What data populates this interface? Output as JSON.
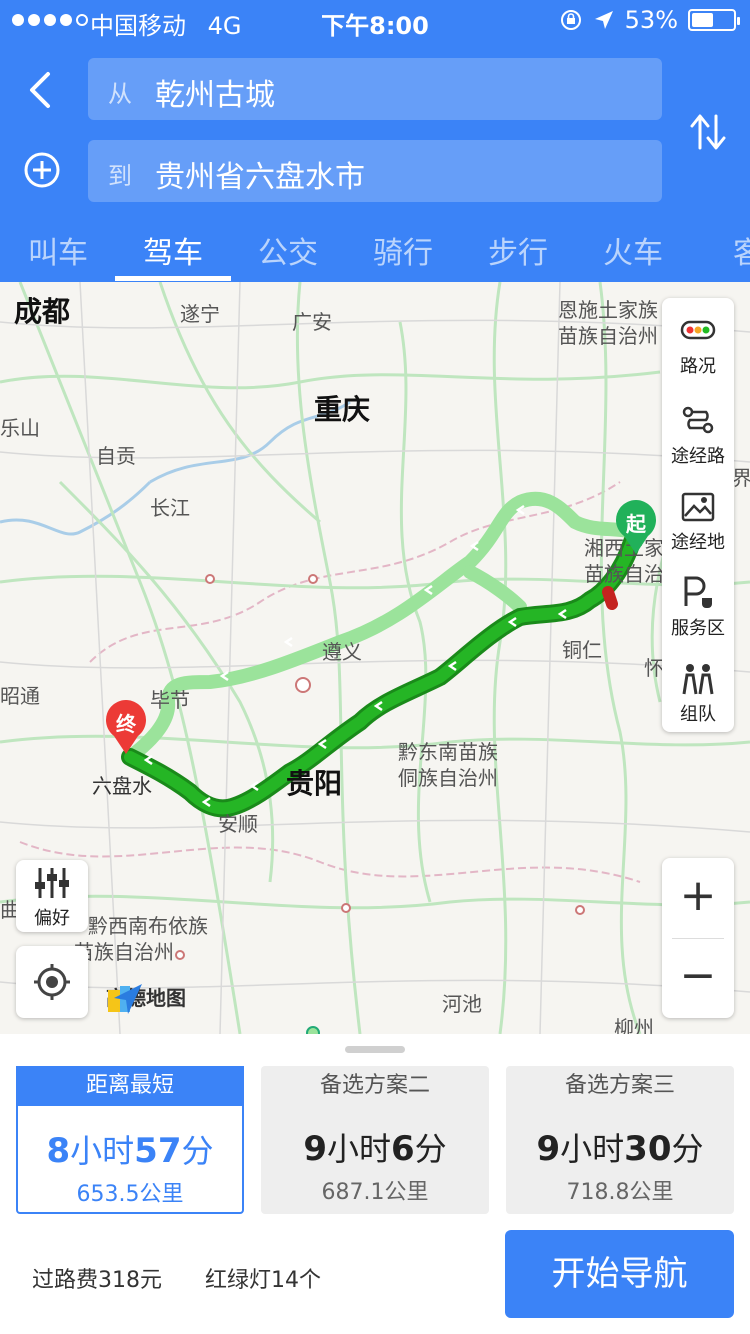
{
  "status_bar": {
    "carrier": "中国移动",
    "network": "4G",
    "time": "下午8:00",
    "battery_percent": "53%",
    "battery_level": 0.53
  },
  "search": {
    "from_tag": "从",
    "from_value": "乾州古城",
    "to_tag": "到",
    "to_value": "贵州省六盘水市"
  },
  "tabs": [
    {
      "label": "叫车"
    },
    {
      "label": "驾车"
    },
    {
      "label": "公交"
    },
    {
      "label": "骑行"
    },
    {
      "label": "步行"
    },
    {
      "label": "火车"
    },
    {
      "label": "客"
    }
  ],
  "active_tab": 1,
  "map": {
    "labels": {
      "chengdu": "成都",
      "suining": "遂宁",
      "guangan": "广安",
      "chongqing": "重庆",
      "leshan": "乐山",
      "zigong": "自贡",
      "changjiang": "长江",
      "zunyi": "遵义",
      "bijie": "毕节",
      "liupanshui": "六盘水",
      "anshun": "安顺",
      "guiyang": "贵阳",
      "qiandongnan_1": "黔东南苗族",
      "qiandongnan_2": "侗族自治州",
      "tongren": "铜仁",
      "enshi_1": "恩施土家族",
      "enshi_2": "苗族自治州",
      "xiangxi_1": "湘西土家",
      "xiangxi_2": "苗族自治",
      "huaihua": "怀",
      "qiannan_1": "黔西南布依族",
      "qiannan_2": "苗族自治州",
      "hechi": "河池",
      "liuzhou": "柳州",
      "zhaotong": "昭通",
      "jie": "界",
      "qu": "曲"
    },
    "start_marker": "起",
    "end_marker": "终",
    "side_buttons": [
      {
        "label": "路况",
        "icon": "traffic-icon"
      },
      {
        "label": "途经路",
        "icon": "via-road-icon"
      },
      {
        "label": "途经地",
        "icon": "via-place-icon"
      },
      {
        "label": "服务区",
        "icon": "service-area-icon"
      },
      {
        "label": "组队",
        "icon": "team-icon"
      }
    ],
    "preference_label": "偏好",
    "zoom_in": "+",
    "zoom_out": "−",
    "logo_text": "高德地图"
  },
  "routes": [
    {
      "header": "距离最短",
      "hours": "8",
      "hour_unit": "小时",
      "minutes": "57",
      "minute_unit": "分",
      "distance": "653.5公里",
      "selected": true
    },
    {
      "header": "备选方案二",
      "hours": "9",
      "hour_unit": "小时",
      "minutes": "6",
      "minute_unit": "分",
      "distance": "687.1公里",
      "selected": false
    },
    {
      "header": "备选方案三",
      "hours": "9",
      "hour_unit": "小时",
      "minutes": "30",
      "minute_unit": "分",
      "distance": "718.8公里",
      "selected": false
    }
  ],
  "summary": {
    "tolls": "过路费318元",
    "traffic_lights": "红绿灯14个"
  },
  "start_nav": "开始导航",
  "colors": {
    "brand_blue": "#3b83f7",
    "route_main": "#1faa1f",
    "route_alt": "#9be39b",
    "start_green": "#21b15a",
    "end_red": "#ec3a36"
  }
}
